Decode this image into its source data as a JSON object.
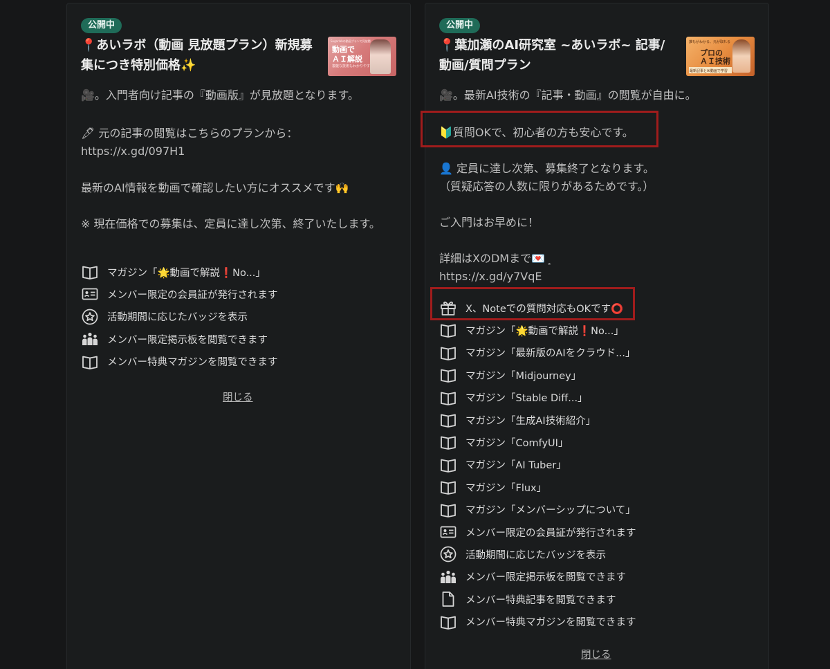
{
  "plans": [
    {
      "status_badge": "公開中",
      "title": "📍あいラボ（動画 見放題プラン）新規募集につき特別価格✨",
      "thumbnail": {
        "text": "動画で\nＡＩ解説",
        "subtext": "複雑な技術もわかりやすく",
        "top_text": "Sugarlabの動画プランで見放題"
      },
      "description": [
        "🎥。入門者向け記事の『動画版』が見放題となります。",
        "🖋 元の記事の閲覧はこちらのプランから：",
        "https://x.gd/097H1",
        "最新のAI情報を動画で確認したい方にオススメです🙌",
        "※ 現在価格での募集は、定員に達し次第、終了いたします。"
      ],
      "features": [
        {
          "icon": "book-icon",
          "label": "マガジン「🌟動画で解説❗No...」"
        },
        {
          "icon": "id-card-icon",
          "label": "メンバー限定の会員証が発行されます"
        },
        {
          "icon": "badge-star-icon",
          "label": "活動期間に応じたバッジを表示"
        },
        {
          "icon": "people-icon",
          "label": "メンバー限定掲示板を閲覧できます"
        },
        {
          "icon": "book-icon",
          "label": "メンバー特典マガジンを閲覧できます"
        }
      ],
      "close_label": "閉じる"
    },
    {
      "status_badge": "公開中",
      "title": "📍葉加瀬のAI研究室 ~あいラボ~ 記事/動画/質問プラン",
      "thumbnail": {
        "text": "プロの\nＡＩ技術",
        "subtext": "最新記事とAI動画で学習",
        "top_text": "誰もがわかる、元が取れる"
      },
      "description": [
        "🎥。最新AI技術の『記事・動画』の閲覧が自由に。",
        "🔰質問OKで、初心者の方も安心です。",
        "👤 定員に達し次第、募集終了となります。",
        "（質疑応答の人数に限りがあるためです。）",
        "ご入門はお早めに！",
        "詳細はXのDMまで💌 ⸼",
        "https://x.gd/y7VqE"
      ],
      "features": [
        {
          "icon": "gift-icon",
          "label": "X、Noteでの質問対応もOKです⭕"
        },
        {
          "icon": "book-icon",
          "label": "マガジン「🌟動画で解説❗No...」"
        },
        {
          "icon": "book-icon",
          "label": "マガジン「最新版のAIをクラウド...」"
        },
        {
          "icon": "book-icon",
          "label": "マガジン「Midjourney」"
        },
        {
          "icon": "book-icon",
          "label": "マガジン「Stable Diff...」"
        },
        {
          "icon": "book-icon",
          "label": "マガジン「生成AI技術紹介」"
        },
        {
          "icon": "book-icon",
          "label": "マガジン「ComfyUI」"
        },
        {
          "icon": "book-icon",
          "label": "マガジン「AI Tuber」"
        },
        {
          "icon": "book-icon",
          "label": "マガジン「Flux」"
        },
        {
          "icon": "book-icon",
          "label": "マガジン「メンバーシップについて」"
        },
        {
          "icon": "id-card-icon",
          "label": "メンバー限定の会員証が発行されます"
        },
        {
          "icon": "badge-star-icon",
          "label": "活動期間に応じたバッジを表示"
        },
        {
          "icon": "people-icon",
          "label": "メンバー限定掲示板を閲覧できます"
        },
        {
          "icon": "document-icon",
          "label": "メンバー特典記事を閲覧できます"
        },
        {
          "icon": "book-icon",
          "label": "メンバー特典マガジンを閲覧できます"
        }
      ],
      "close_label": "閉じる"
    }
  ],
  "colors": {
    "badge": "#1f6b58",
    "highlight": "#a01c1c",
    "background": "#161718",
    "card": "#1a1c1d"
  }
}
